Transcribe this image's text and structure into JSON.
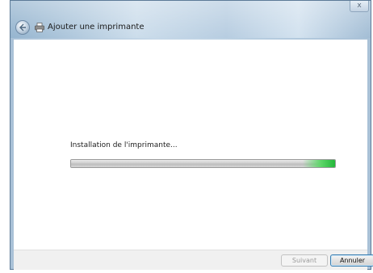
{
  "window": {
    "title": "Ajouter une imprimante",
    "close_glyph": "x"
  },
  "icons": {
    "back": "back-arrow-icon",
    "printer": "printer-icon",
    "close": "close-icon"
  },
  "main": {
    "status_label": "Installation de l'imprimante...",
    "progress": 1.0
  },
  "footer": {
    "next_label": "Suivant",
    "cancel_label": "Annuler"
  }
}
